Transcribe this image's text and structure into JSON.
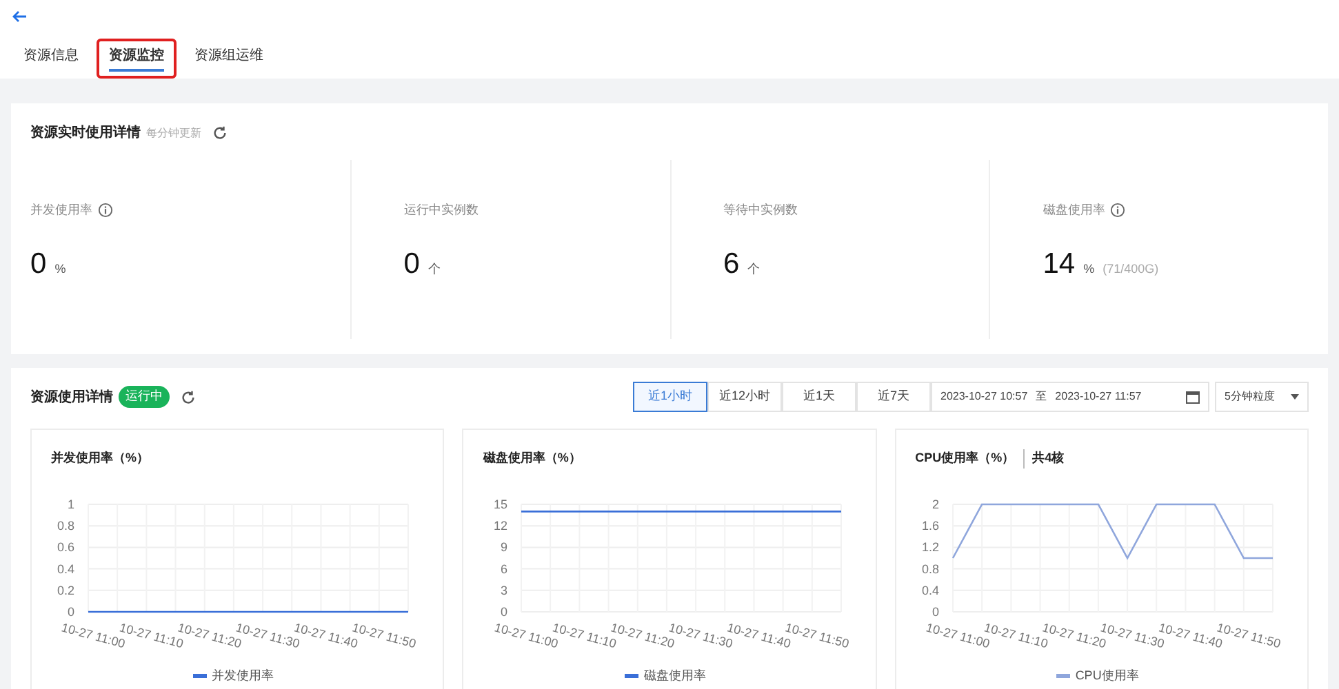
{
  "tabs": [
    {
      "label": "资源信息",
      "selected": false,
      "highlighted": false
    },
    {
      "label": "资源监控",
      "selected": true,
      "highlighted": true
    },
    {
      "label": "资源组运维",
      "selected": false,
      "highlighted": false
    }
  ],
  "realtime": {
    "title": "资源实时使用详情",
    "note": "每分钟更新",
    "metrics": [
      {
        "label": "并发使用率",
        "info": true,
        "value": "0",
        "unit": "%"
      },
      {
        "label": "运行中实例数",
        "info": false,
        "value": "0",
        "unit": "个"
      },
      {
        "label": "等待中实例数",
        "info": false,
        "value": "6",
        "unit": "个"
      },
      {
        "label": "磁盘使用率",
        "info": true,
        "value": "14",
        "unit": "%",
        "extra": "(71/400G)"
      }
    ]
  },
  "usage": {
    "title": "资源使用详情",
    "status": "运行中",
    "ranges": [
      {
        "label": "近1小时",
        "selected": true
      },
      {
        "label": "近12小时",
        "selected": false
      },
      {
        "label": "近1天",
        "selected": false
      },
      {
        "label": "近7天",
        "selected": false
      }
    ],
    "date_start": "2023-10-27 10:57",
    "date_sep": "至",
    "date_end": "2023-10-27 11:57",
    "granularity": "5分钟粒度",
    "charts": [
      {
        "title": "并发使用率（%）",
        "chart_data": {
          "type": "line",
          "grid": true,
          "categories": [
            "10-27 11:00",
            null,
            "10-27 11:10",
            null,
            "10-27 11:20",
            null,
            "10-27 11:30",
            null,
            "10-27 11:40",
            null,
            "10-27 11:50",
            null
          ],
          "ylim": [
            0,
            1
          ],
          "yticks": [
            0,
            0.2,
            0.4,
            0.6,
            0.8,
            1
          ],
          "series": [
            {
              "name": "并发使用率",
              "color": "#3a6fd8",
              "values": [
                0,
                0,
                0,
                0,
                0,
                0,
                0,
                0,
                0,
                0,
                0,
                0
              ]
            }
          ]
        }
      },
      {
        "title": "磁盘使用率（%）",
        "chart_data": {
          "type": "line",
          "grid": true,
          "categories": [
            "10-27 11:00",
            null,
            "10-27 11:10",
            null,
            "10-27 11:20",
            null,
            "10-27 11:30",
            null,
            "10-27 11:40",
            null,
            "10-27 11:50",
            null
          ],
          "ylim": [
            0,
            15
          ],
          "yticks": [
            0,
            3,
            6,
            9,
            12,
            15
          ],
          "series": [
            {
              "name": "磁盘使用率",
              "color": "#3a6fd8",
              "values": [
                14,
                14,
                14,
                14,
                14,
                14,
                14,
                14,
                14,
                14,
                14,
                14
              ]
            }
          ]
        }
      },
      {
        "title": "CPU使用率（%）",
        "subtitle": "共4核",
        "chart_data": {
          "type": "line",
          "grid": true,
          "categories": [
            "10-27 11:00",
            null,
            "10-27 11:10",
            null,
            "10-27 11:20",
            null,
            "10-27 11:30",
            null,
            "10-27 11:40",
            null,
            "10-27 11:50",
            null
          ],
          "ylim": [
            0,
            2
          ],
          "yticks": [
            0,
            0.4,
            0.8,
            1.2,
            1.6,
            2
          ],
          "series": [
            {
              "name": "CPU使用率",
              "color": "#8fa6dc",
              "values": [
                1,
                2,
                2,
                2,
                2,
                2,
                1,
                2,
                2,
                2,
                1,
                1
              ]
            }
          ]
        }
      }
    ]
  }
}
